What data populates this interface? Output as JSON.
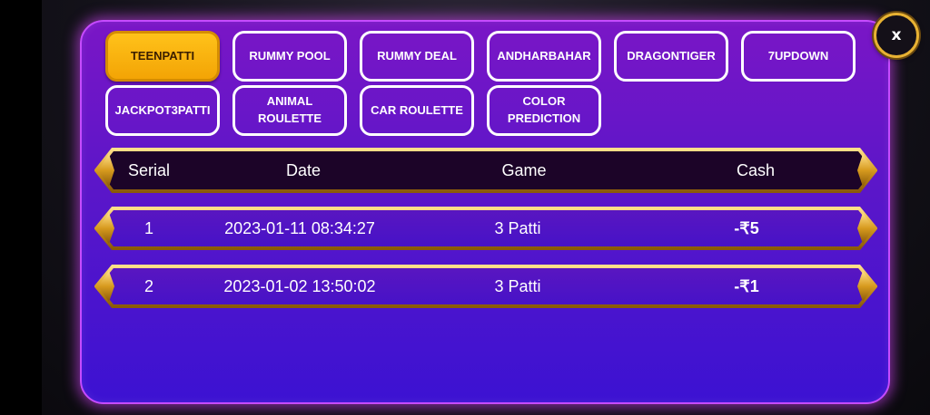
{
  "close_label": "x",
  "tabs": [
    {
      "label": "TEENPATTI",
      "active": true
    },
    {
      "label": "RUMMY POOL",
      "active": false
    },
    {
      "label": "RUMMY DEAL",
      "active": false
    },
    {
      "label": "ANDHARBAHAR",
      "active": false
    },
    {
      "label": "DRAGONTIGER",
      "active": false
    },
    {
      "label": "7UPDOWN",
      "active": false
    },
    {
      "label": "JACKPOT3PATTI",
      "active": false
    },
    {
      "label": "ANIMAL ROULETTE",
      "active": false
    },
    {
      "label": "CAR ROULETTE",
      "active": false
    },
    {
      "label": "COLOR\nPREDICTION",
      "active": false
    }
  ],
  "table": {
    "headers": {
      "serial": "Serial",
      "date": "Date",
      "game": "Game",
      "cash": "Cash"
    },
    "rows": [
      {
        "serial": "1",
        "date": "2023-01-11 08:34:27",
        "game": "3 Patti",
        "cash": "-₹5"
      },
      {
        "serial": "2",
        "date": "2023-01-02 13:50:02",
        "game": "3 Patti",
        "cash": "-₹1"
      }
    ]
  },
  "colors": {
    "panel_top": "#7a16c6",
    "panel_bottom": "#3c12d2",
    "active_tab": "#f3a405",
    "gold_border": "#e8b233",
    "header_fill": "#1c0428",
    "negative_cash": "#e3162a"
  }
}
